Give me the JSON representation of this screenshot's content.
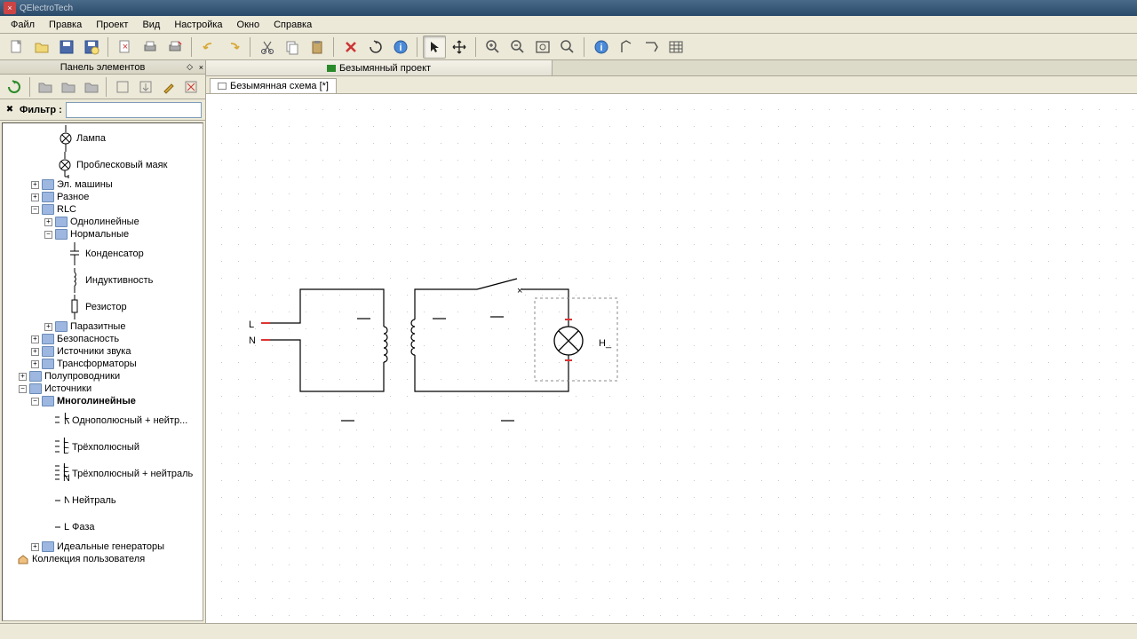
{
  "app": {
    "title": "QElectroTech"
  },
  "menu": {
    "items": [
      "Файл",
      "Правка",
      "Проект",
      "Вид",
      "Настройка",
      "Окно",
      "Справка"
    ]
  },
  "sidebar": {
    "panel_title": "Панель элементов",
    "filter_label": "Фильтр :",
    "filter_value": "",
    "items": {
      "lamp": "Лампа",
      "beacon": "Проблесковый маяк",
      "el_machines": "Эл. машины",
      "misc": "Разное",
      "rlc": "RLC",
      "single_line": "Однолинейные",
      "normal": "Нормальные",
      "capacitor": "Конденсатор",
      "inductor": "Индуктивность",
      "resistor": "Резистор",
      "parasitic": "Паразитные",
      "safety": "Безопасность",
      "sound_src": "Источники звука",
      "transformers": "Трансформаторы",
      "semiconductors": "Полупроводники",
      "sources": "Источники",
      "multiline": "Многолинейные",
      "single_pole_n": "Однополюсный + нейтр...",
      "three_pole": "Трёхполюсный",
      "three_pole_n": "Трёхполюсный + нейтраль",
      "neutral": "Нейтраль",
      "phase": "Фаза",
      "ideal_gen": "Идеальные генераторы",
      "user_coll": "Коллекция пользователя"
    }
  },
  "content": {
    "project_tab": "Безымянный проект",
    "sheet_tab": "Безымянная схема [*]"
  },
  "schematic": {
    "labels": {
      "L": "L",
      "N": "N",
      "H": "H_"
    }
  }
}
